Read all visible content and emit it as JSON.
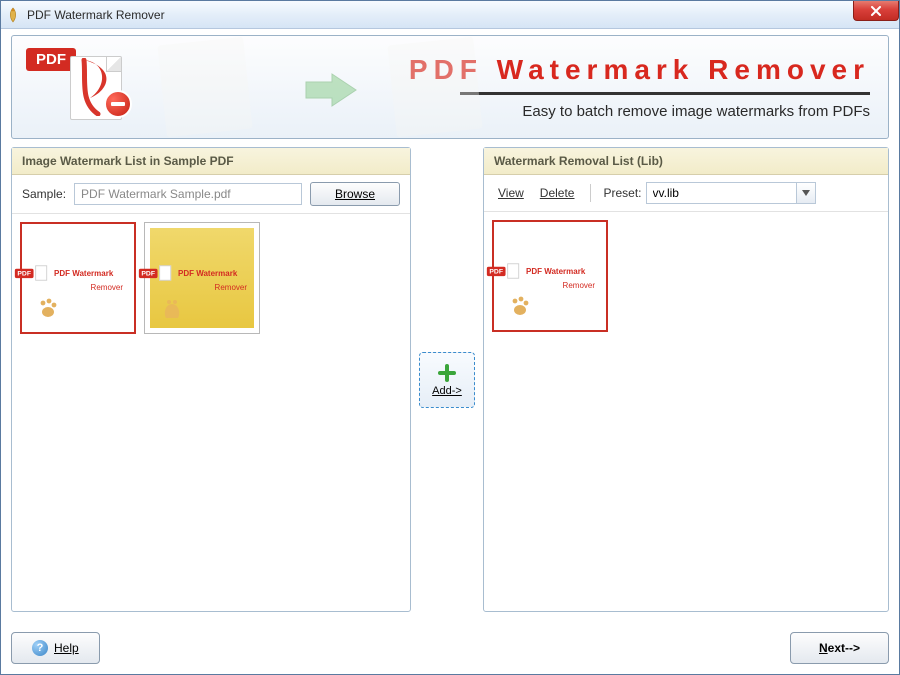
{
  "window": {
    "title": "PDF Watermark Remover"
  },
  "banner": {
    "pdf_badge_label": "PDF",
    "app_title": "PDF  Watermark  Remover",
    "tagline": "Easy to batch remove image watermarks from PDFs"
  },
  "left_panel": {
    "header": "Image Watermark List  in Sample PDF",
    "sample_label": "Sample:",
    "sample_value": "PDF Watermark Sample.pdf",
    "browse_label": "Browse",
    "thumbs": [
      {
        "selected": true,
        "style": "white"
      },
      {
        "selected": false,
        "style": "yellow"
      }
    ]
  },
  "center": {
    "add_label": "Add->"
  },
  "right_panel": {
    "header": "Watermark Removal List (Lib)",
    "view_label": "View",
    "delete_label": "Delete",
    "preset_label": "Preset:",
    "preset_value": "vv.lib",
    "thumbs": [
      {
        "selected": true,
        "style": "white"
      }
    ]
  },
  "footer": {
    "help_label": "Help",
    "next_label": "Next-->"
  },
  "mini": {
    "chip": "PDF",
    "title": "PDF Watermark",
    "sub": "Remover"
  }
}
